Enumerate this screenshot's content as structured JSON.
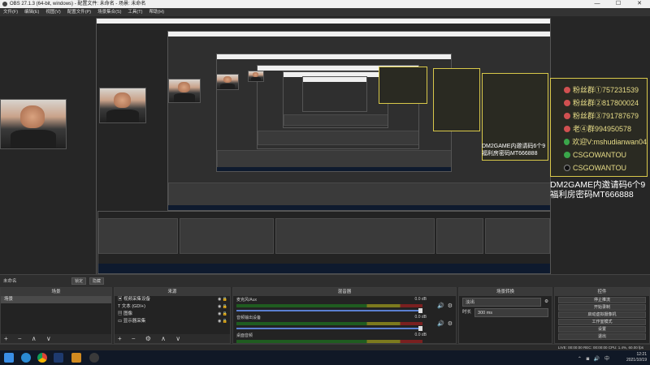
{
  "window": {
    "title": "OBS 27.1.3 (64-bit, windows) - 配置文件: 未命名 - 场景: 未命名",
    "controls": [
      "—",
      "☐",
      "✕"
    ]
  },
  "menu": [
    "文件(F)",
    "编辑(E)",
    "视图(V)",
    "配置文件(P)",
    "场景集合(S)",
    "工具(T)",
    "帮助(H)"
  ],
  "overlay": {
    "fans": [
      {
        "label": "粉丝群①757231539",
        "color": "#d05050"
      },
      {
        "label": "粉丝群②817800024",
        "color": "#d05050"
      },
      {
        "label": "粉丝群③791787679",
        "color": "#d05050"
      },
      {
        "label": "老④群994950578",
        "color": "#d05050"
      },
      {
        "label": "欢迎V:mshudianwan04",
        "color": "#3aa64a"
      },
      {
        "label": "CSGOWANTOU",
        "color": "#3aa64a"
      },
      {
        "label": "CSGOWANTOU",
        "color": "#202020"
      }
    ],
    "promo_line1": "DM2GAME内邀请码6个9",
    "promo_line2": "福利房密码MT666888"
  },
  "scene_bar": {
    "scene_name": "未命名",
    "btn_lock": "锁定",
    "btn_hide": "隐藏"
  },
  "docks": {
    "scenes": {
      "title": "场景",
      "items": [
        "场景"
      ],
      "footer": "+ − ∧ ∨"
    },
    "sources": {
      "title": "来源",
      "items": [
        "视频采集设备",
        "文本 (GDI+)",
        "图像",
        "显示器采集"
      ],
      "footer": "+ − ⚙ ∧ ∨"
    },
    "mixer": {
      "title": "混音器",
      "channels": [
        {
          "name": "麦克风/Aux",
          "db": "0.0 dB"
        },
        {
          "name": "音频输出设备",
          "db": "0.0 dB"
        },
        {
          "name": "桌面音频",
          "db": "0.0 dB"
        }
      ]
    },
    "transitions": {
      "title": "场景转换",
      "type": "淡出",
      "duration_label": "时长",
      "duration_value": "300 ms"
    },
    "controls": {
      "title": "控件",
      "buttons": [
        "停止推流",
        "开始录制",
        "启动虚拟摄像机",
        "工作室模式",
        "设置",
        "退出"
      ]
    }
  },
  "status": {
    "text": "LIVE: 00:00:00  REC: 00:00:00  CPU: 1.4%, 60.00 fps"
  },
  "taskbar": {
    "time": "12:21",
    "date": "2021/10/19"
  }
}
